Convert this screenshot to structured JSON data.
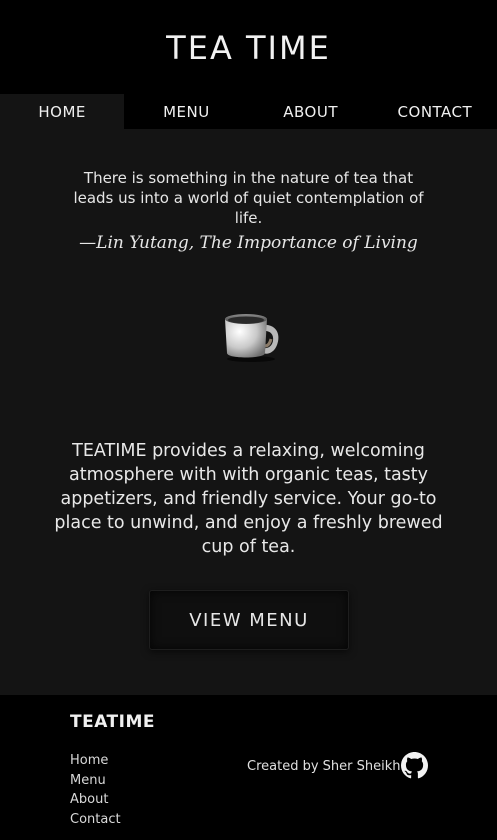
{
  "header": {
    "title": "TEA TIME"
  },
  "nav": {
    "items": [
      {
        "label": "HOME",
        "active": true
      },
      {
        "label": "MENU",
        "active": false
      },
      {
        "label": "ABOUT",
        "active": false
      },
      {
        "label": "CONTACT",
        "active": false
      }
    ]
  },
  "hero": {
    "quote": "There is something in the nature of tea that leads us into a world of quiet contemplation of life.",
    "attribution": "—Lin Yutang, The Importance of Living",
    "image_icon": "tea-mug-icon",
    "description": "TEATIME provides a relaxing, welcoming atmosphere with with organic teas, tasty appetizers, and friendly service. Your go-to place to unwind, and enjoy a freshly brewed cup of tea.",
    "button_label": "VIEW MENU"
  },
  "footer": {
    "brand": "TEATIME",
    "links": [
      "Home",
      "Menu",
      "About",
      "Contact"
    ],
    "credit": "Created by Sher Sheikh",
    "github_icon": "github-icon"
  },
  "colors": {
    "background": "#000000",
    "panel": "#141414",
    "text": "#ececec"
  }
}
